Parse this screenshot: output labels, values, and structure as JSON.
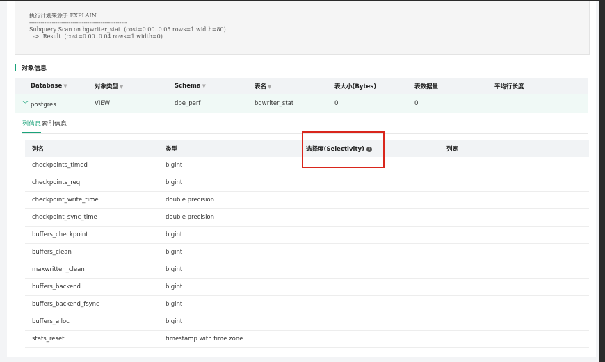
{
  "explain": {
    "title": "执行计划来源于 EXPLAIN",
    "divider": "----------------------------------------------------",
    "line1": "Subquery Scan on bgwriter_stat  (cost=0.00..0.05 rows=1 width=80)",
    "line2": "  ->  Result  (cost=0.00..0.04 rows=1 width=0)"
  },
  "object_info": {
    "title": "对象信息",
    "headers": [
      "Database",
      "对象类型",
      "Schema",
      "表名",
      "表大小(Bytes)",
      "表数据量",
      "平均行长度"
    ],
    "row": [
      "postgres",
      "VIEW",
      "dbe_perf",
      "bgwriter_stat",
      "0",
      "0",
      ""
    ]
  },
  "tabs": [
    {
      "label": "列信息",
      "active": true
    },
    {
      "label": "索引信息",
      "active": false
    }
  ],
  "columns_table": {
    "headers": [
      "列名",
      "类型",
      "选择度(Selectivity)",
      "列宽"
    ],
    "rows": [
      [
        "checkpoints_timed",
        "bigint"
      ],
      [
        "checkpoints_req",
        "bigint"
      ],
      [
        "checkpoint_write_time",
        "double precision"
      ],
      [
        "checkpoint_sync_time",
        "double precision"
      ],
      [
        "buffers_checkpoint",
        "bigint"
      ],
      [
        "buffers_clean",
        "bigint"
      ],
      [
        "maxwritten_clean",
        "bigint"
      ],
      [
        "buffers_backend",
        "bigint"
      ],
      [
        "buffers_backend_fsync",
        "bigint"
      ],
      [
        "buffers_alloc",
        "bigint"
      ],
      [
        "stats_reset",
        "timestamp with time zone"
      ]
    ]
  },
  "colors": {
    "accent": "#1aa37a",
    "highlight": "#d9261c"
  },
  "icons": {
    "filter": "filter-icon",
    "expand": "chevron-down-icon",
    "info": "info-icon"
  }
}
